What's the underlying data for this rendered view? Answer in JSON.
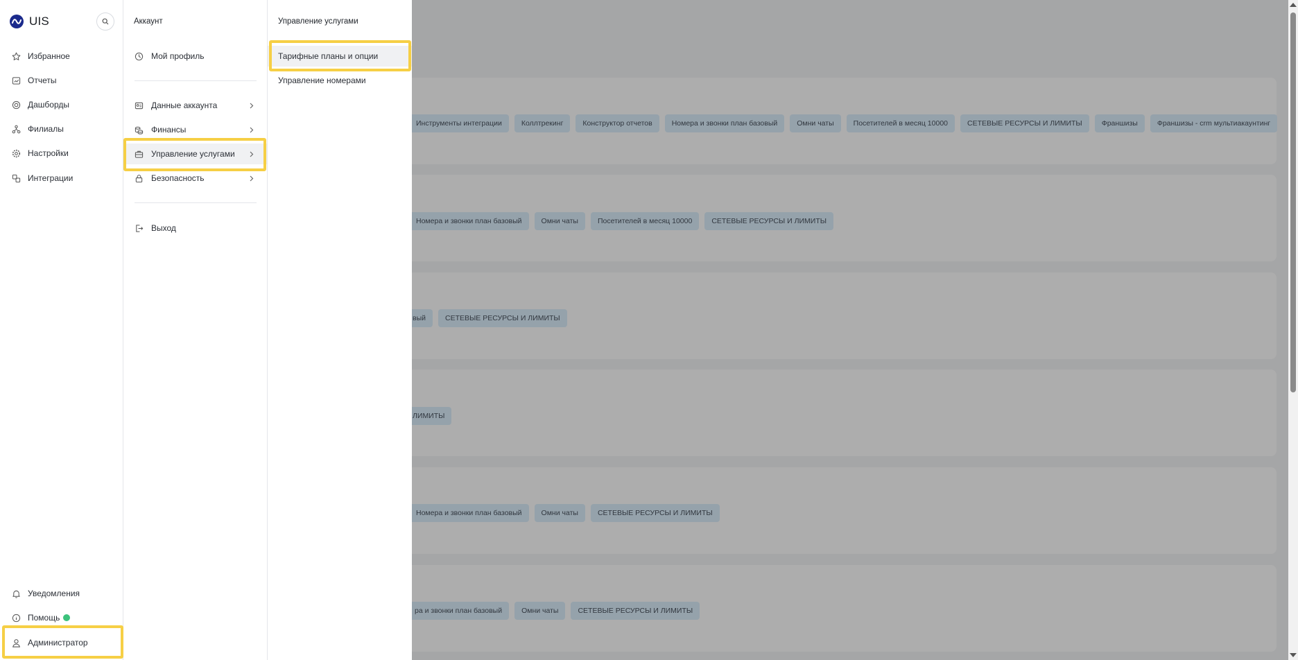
{
  "app": {
    "logo_text": "UIS"
  },
  "sidebar": {
    "items": [
      {
        "label": "Избранное",
        "icon": "star-icon"
      },
      {
        "label": "Отчеты",
        "icon": "reports-icon"
      },
      {
        "label": "Дашборды",
        "icon": "dashboards-icon"
      },
      {
        "label": "Филиалы",
        "icon": "branches-icon"
      },
      {
        "label": "Настройки",
        "icon": "gear-icon"
      },
      {
        "label": "Интеграции",
        "icon": "integrations-icon"
      }
    ],
    "bottom": [
      {
        "label": "Уведомления",
        "icon": "bell-icon"
      },
      {
        "label": "Помощь",
        "icon": "info-icon",
        "status_color": "#3cc27c"
      },
      {
        "label": "Администратор",
        "icon": "user-icon"
      }
    ]
  },
  "account_menu": {
    "title": "Аккаунт",
    "profile": "Мой профиль",
    "items": [
      {
        "label": "Данные аккаунта",
        "icon": "account-data-icon"
      },
      {
        "label": "Финансы",
        "icon": "coins-icon"
      },
      {
        "label": "Управление услугами",
        "icon": "briefcase-icon"
      },
      {
        "label": "Безопасность",
        "icon": "lock-icon"
      }
    ],
    "logout": "Выход"
  },
  "services_menu": {
    "title": "Управление услугами",
    "items": [
      {
        "label": "Тарифные планы и опции"
      },
      {
        "label": "Управление номерами"
      }
    ]
  },
  "background_cards": [
    {
      "tags": [
        "Инструменты интеграции",
        "Коллтрекинг",
        "Конструктор отчетов",
        "Номера и звонки план базовый",
        "Омни чаты",
        "Посетителей в месяц 10000",
        "СЕТЕВЫЕ РЕСУРСЫ И ЛИМИТЫ",
        "Франшизы",
        "Франшизы - crm мультиакаунтинг"
      ]
    },
    {
      "tags": [
        "Номера и звонки план базовый",
        "Омни чаты",
        "Посетителей в месяц 10000",
        "СЕТЕВЫЕ РЕСУРСЫ И ЛИМИТЫ"
      ]
    },
    {
      "tags": [
        "вый",
        "СЕТЕВЫЕ РЕСУРСЫ И ЛИМИТЫ"
      ]
    },
    {
      "tags": [
        "ЛИМИТЫ"
      ]
    },
    {
      "tags": [
        "Номера и звонки план базовый",
        "Омни чаты",
        "СЕТЕВЫЕ РЕСУРСЫ И ЛИМИТЫ"
      ]
    },
    {
      "tags": [
        "ра и звонки план базовый",
        "Омни чаты",
        "СЕТЕВЫЕ РЕСУРСЫ И ЛИМИТЫ"
      ]
    }
  ],
  "colors": {
    "highlight": "#f6cf45",
    "brand": "#1b2a8c",
    "tag_bg": "#d6ecfb"
  }
}
